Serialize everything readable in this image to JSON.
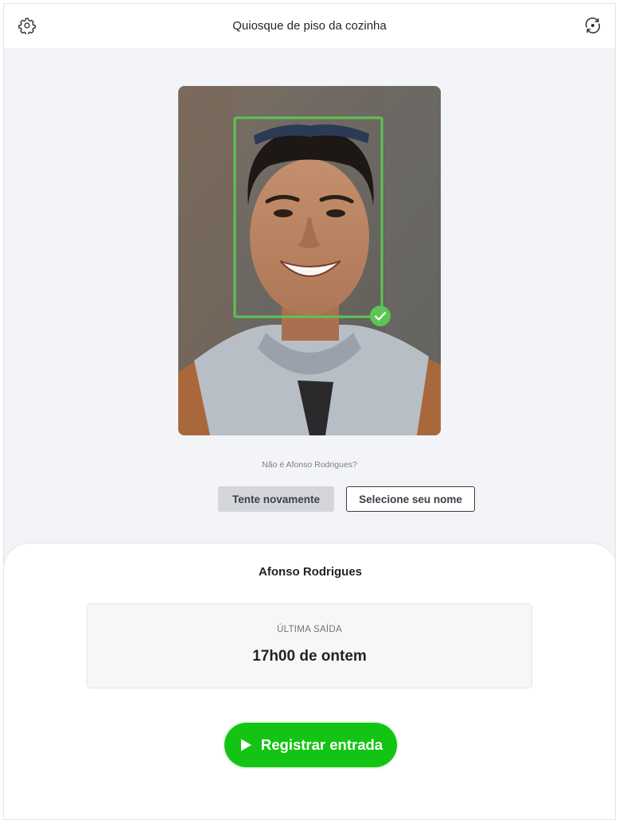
{
  "header": {
    "title": "Quiosque de piso da cozinha",
    "left_icon": "gear-icon",
    "right_icon": "switch-camera-icon"
  },
  "recognition": {
    "photo": "face-photo",
    "status_icon": "check-icon",
    "frame_color": "#5cc553",
    "question": "Não é Afonso Rodrigues?",
    "retry_label": "Tente novamente",
    "select_label": "Selecione seu nome"
  },
  "employee": {
    "name": "Afonso Rodrigues",
    "last_label": "ÚLTIMA SAÍDA",
    "last_value": "17h00 de ontem"
  },
  "action": {
    "label": "Registrar entrada",
    "icon": "play-icon",
    "color": "#14c414"
  }
}
